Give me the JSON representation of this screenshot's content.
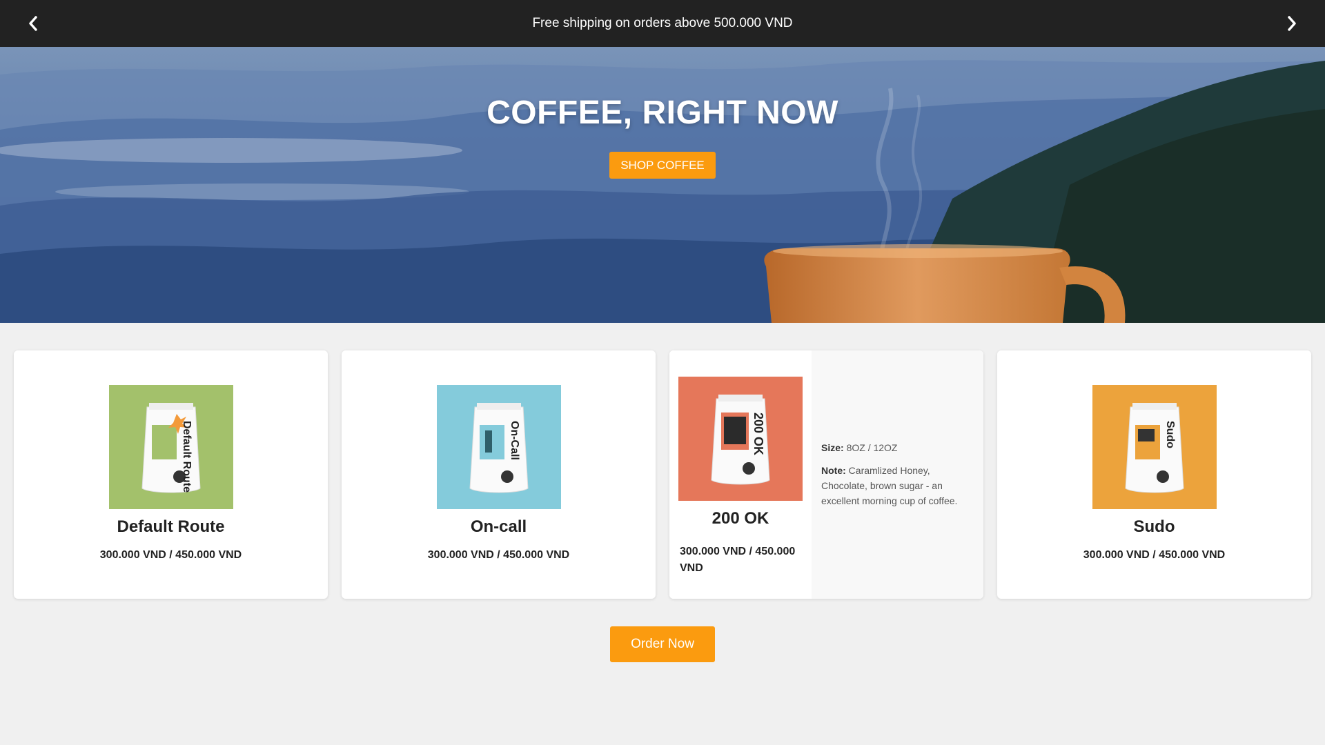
{
  "announcement": {
    "message": "Free shipping on orders above 500.000 VND",
    "prev_icon": "chevron-left-icon",
    "next_icon": "chevron-right-icon"
  },
  "hero": {
    "title": "COFFEE, RIGHT NOW",
    "button_label": "SHOP COFFEE"
  },
  "products": [
    {
      "name": "Default Route",
      "price": "300.000 VND / 450.000 VND",
      "bag_label": "Default Route",
      "color": "#a3c16b"
    },
    {
      "name": "On-call",
      "price": "300.000 VND / 450.000 VND",
      "bag_label": "On-Call",
      "color": "#84cbdb"
    },
    {
      "name": "200 OK",
      "price": "300.000 VND / 450.000 VND",
      "bag_label": "200 OK",
      "color": "#e5775a",
      "size_label": "Size:",
      "size_value": " 8OZ / 12OZ",
      "note_label": "Note:",
      "note_value": " Caramlized Honey, Chocolate, brown sugar - an excellent morning cup of coffee."
    },
    {
      "name": "Sudo",
      "price": "300.000 VND / 450.000 VND",
      "bag_label": "Sudo",
      "color": "#eca33c"
    }
  ],
  "order_button_label": "Order Now",
  "colors": {
    "accent": "#fb9b0f",
    "topbar": "#222222",
    "page_bg": "#f0f0f0"
  }
}
